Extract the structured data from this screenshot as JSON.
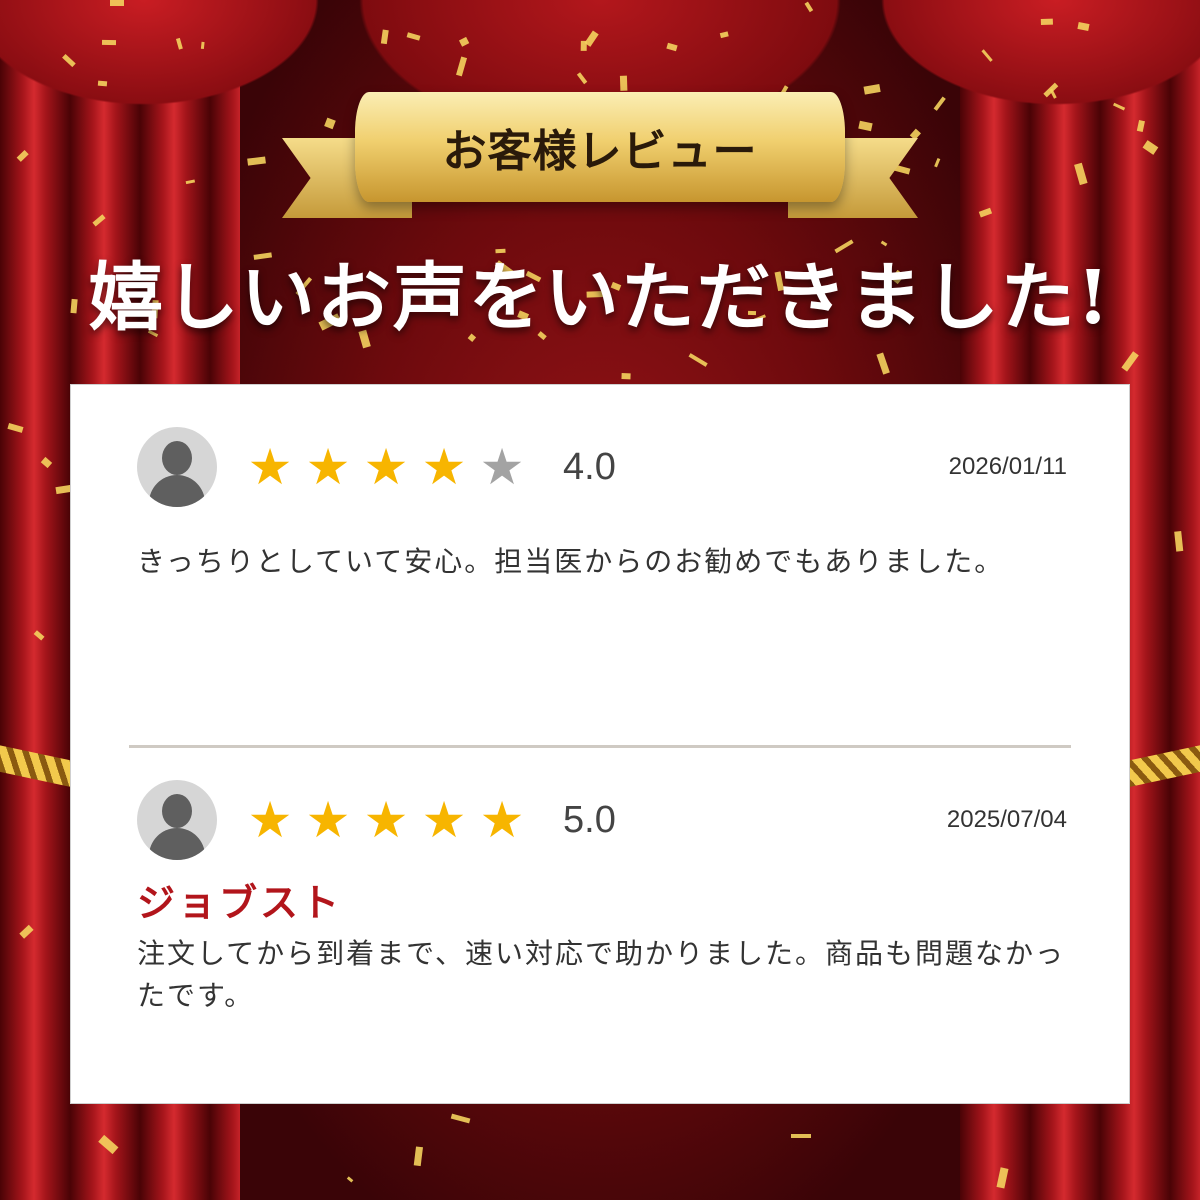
{
  "banner": {
    "ribbon_text": "お客様レビュー",
    "headline": "嬉しいお声をいただきました!"
  },
  "reviews": [
    {
      "rating": 4,
      "rating_label": "4.0",
      "date": "2026/01/11",
      "reviewer": "",
      "text": "きっちりとしていて安心。担当医からのお勧めでもありました。"
    },
    {
      "rating": 5,
      "rating_label": "5.0",
      "date": "2025/07/04",
      "reviewer": "ジョブスト",
      "text": "注文してから到着まで、速い対応で助かりました。商品も問題なかったです。"
    }
  ],
  "colors": {
    "star_on": "#f7b500",
    "star_off": "#a3a3a3",
    "reviewer_name": "#b2151b",
    "curtain": "#a3141a",
    "ribbon_gold": "#f0cf6e"
  },
  "icons": [
    "person-avatar-icon",
    "star-icon"
  ]
}
